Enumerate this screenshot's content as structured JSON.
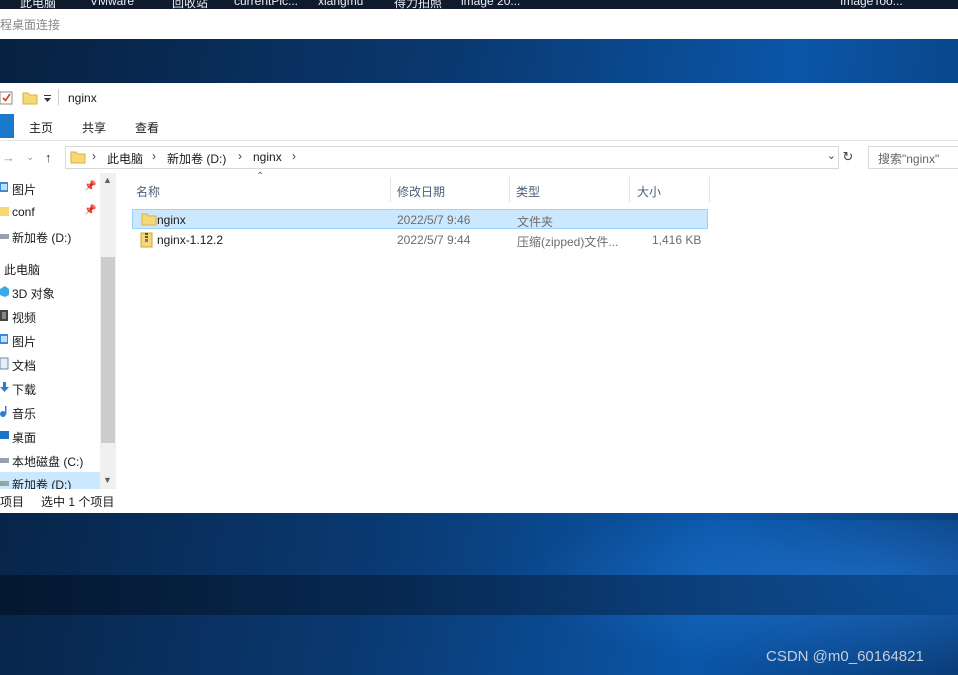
{
  "taskbar_items": [
    "此电脑",
    "VMware",
    "回收站",
    "currentPic...",
    "xiangmu",
    "得力拍照",
    "image 20...",
    "ImageToo..."
  ],
  "rdp_title": "程桌面连接",
  "window": {
    "title": "nginx"
  },
  "ribbon": {
    "tabs": [
      "主页",
      "共享",
      "查看"
    ]
  },
  "address": {
    "crumbs": [
      "此电脑",
      "新加卷 (D:)",
      "nginx"
    ],
    "search_placeholder": "搜索\"nginx\""
  },
  "nav": {
    "items": [
      {
        "label": "图片",
        "icon": "pictures-icon",
        "pinned": true
      },
      {
        "label": "conf",
        "icon": "folder-icon",
        "pinned": true
      },
      {
        "label": "新加卷 (D:)",
        "icon": "drive-icon",
        "pinned": false
      },
      {
        "label": "此电脑",
        "icon": "this-pc-icon",
        "pinned": false
      },
      {
        "label": "3D 对象",
        "icon": "3d-objects-icon",
        "pinned": false
      },
      {
        "label": "视频",
        "icon": "videos-icon",
        "pinned": false
      },
      {
        "label": "图片",
        "icon": "pictures-icon",
        "pinned": false
      },
      {
        "label": "文档",
        "icon": "documents-icon",
        "pinned": false
      },
      {
        "label": "下载",
        "icon": "downloads-icon",
        "pinned": false
      },
      {
        "label": "音乐",
        "icon": "music-icon",
        "pinned": false
      },
      {
        "label": "桌面",
        "icon": "desktop-icon",
        "pinned": false
      },
      {
        "label": "本地磁盘 (C:)",
        "icon": "drive-icon",
        "pinned": false
      },
      {
        "label": "新加卷 (D:)",
        "icon": "drive-icon",
        "pinned": false
      }
    ],
    "selected": "新加卷 (D:)"
  },
  "columns": [
    "名称",
    "修改日期",
    "类型",
    "大小"
  ],
  "files": [
    {
      "name": "nginx",
      "date": "2022/5/7 9:46",
      "type": "文件夹",
      "size": "",
      "icon": "folder-icon",
      "selected": true
    },
    {
      "name": "nginx-1.12.2",
      "date": "2022/5/7 9:44",
      "type": "压缩(zipped)文件...",
      "size": "1,416 KB",
      "icon": "zip-folder-icon",
      "selected": false
    }
  ],
  "status": {
    "count": "项目",
    "selection": "选中 1 个项目"
  },
  "watermark": "CSDN @m0_60164821",
  "colors": {
    "accent": "#1979ca",
    "selection": "#cce8ff",
    "selection_border": "#99d1ff",
    "folder": "#f8d775"
  }
}
